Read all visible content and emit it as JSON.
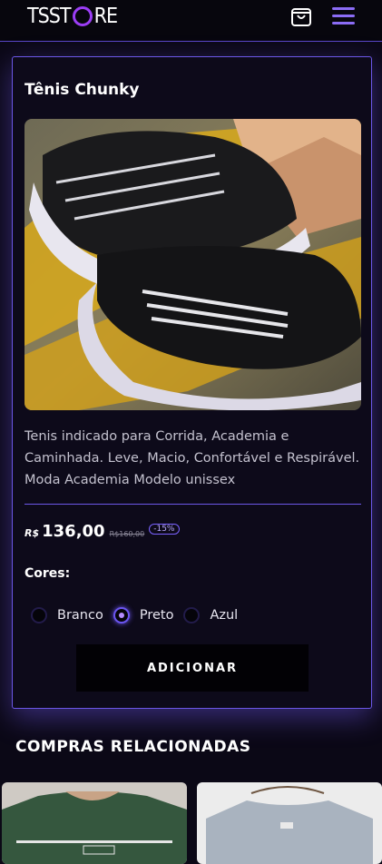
{
  "header": {
    "logo_text": "TSSTORE",
    "cart_icon": "shopping-bag-icon",
    "menu_icon": "hamburger-menu-icon"
  },
  "product": {
    "title": "Tênis Chunky",
    "image_alt": "Tênis Chunky",
    "description": "Tenis indicado para Corrida, Academia e Caminhada. Leve, Macio, Confortável e Respirável. Moda Academia Modelo unissex",
    "currency": "R$",
    "price": "136,00",
    "old_price": "R$160,00",
    "discount": "-15%",
    "colors_label": "Cores:",
    "colors": [
      {
        "label": "Branco",
        "selected": false
      },
      {
        "label": "Preto",
        "selected": true
      },
      {
        "label": "Azul",
        "selected": false
      }
    ],
    "add_button": "ADICIONAR"
  },
  "related": {
    "title": "COMPRAS RELACIONADAS"
  },
  "colors": {
    "accent": "#6c57e8",
    "background": "#0b0816"
  }
}
